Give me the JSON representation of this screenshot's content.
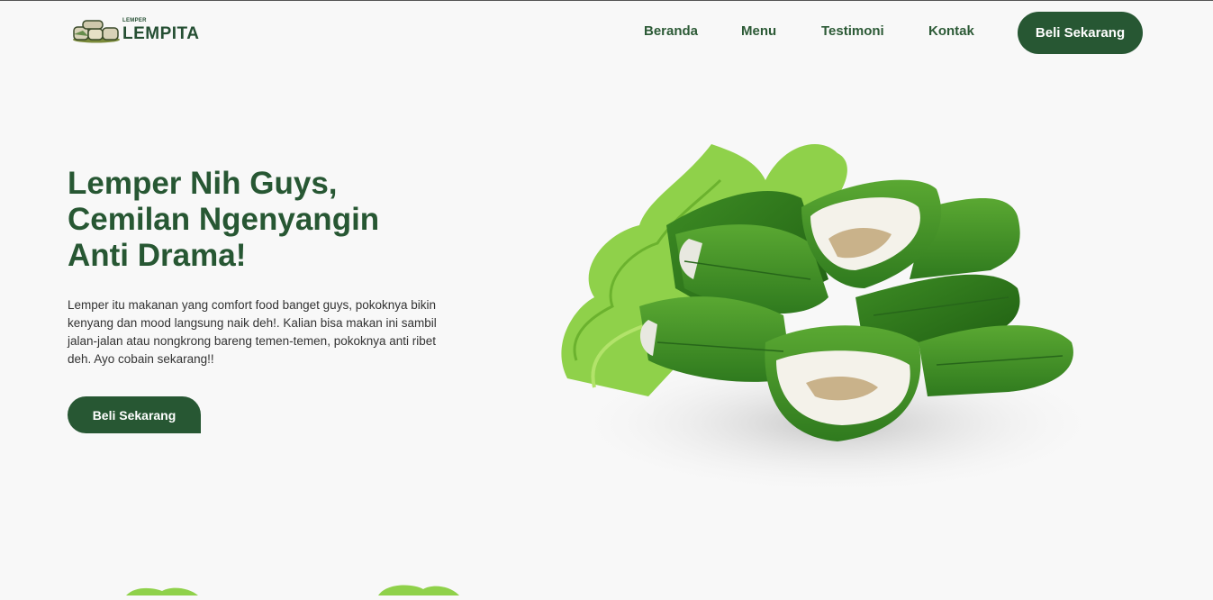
{
  "brand": {
    "small": "LEMPER",
    "name": "LEMPITA"
  },
  "nav": {
    "items": [
      {
        "label": "Beranda"
      },
      {
        "label": "Menu"
      },
      {
        "label": "Testimoni"
      },
      {
        "label": "Kontak"
      }
    ],
    "cta_label": "Beli Sekarang"
  },
  "hero": {
    "title_lines": [
      "Lemper Nih Guys,",
      "Cemilan Ngenyangin",
      "Anti Drama!"
    ],
    "description": "Lemper itu makanan yang comfort food banget guys, pokoknya bikin kenyang dan mood langsung naik deh!. Kalian bisa makan ini sambil jalan-jalan atau nongkrong bareng temen-temen, pokoknya anti ribet deh. Ayo cobain sekarang!!",
    "cta_label": "Beli Sekarang",
    "image_icon": "lemper-plate-image"
  },
  "colors": {
    "primary": "#275733",
    "background": "#f8f8f8",
    "leaf": "#3f8f2a",
    "lettuce": "#8fd14a"
  }
}
